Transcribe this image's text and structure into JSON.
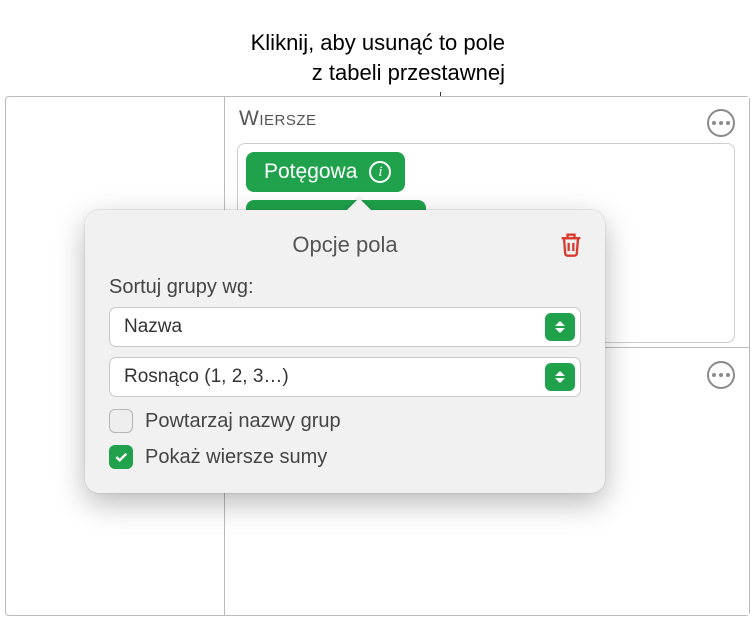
{
  "callout": {
    "line1": "Kliknij, aby usunąć to pole",
    "line2": "z tabeli przestawnej"
  },
  "section": {
    "title": "Wiersze"
  },
  "field": {
    "label": "Potęgowa"
  },
  "popover": {
    "title": "Opcje pola",
    "sort_label": "Sortuj grupy wg:",
    "sort_by": "Nazwa",
    "sort_order": "Rosnąco (1, 2, 3…)",
    "repeat_group_names": "Powtarzaj nazwy grup",
    "show_sum_rows": "Pokaż wiersze sumy",
    "repeat_checked": false,
    "show_sum_checked": true
  }
}
